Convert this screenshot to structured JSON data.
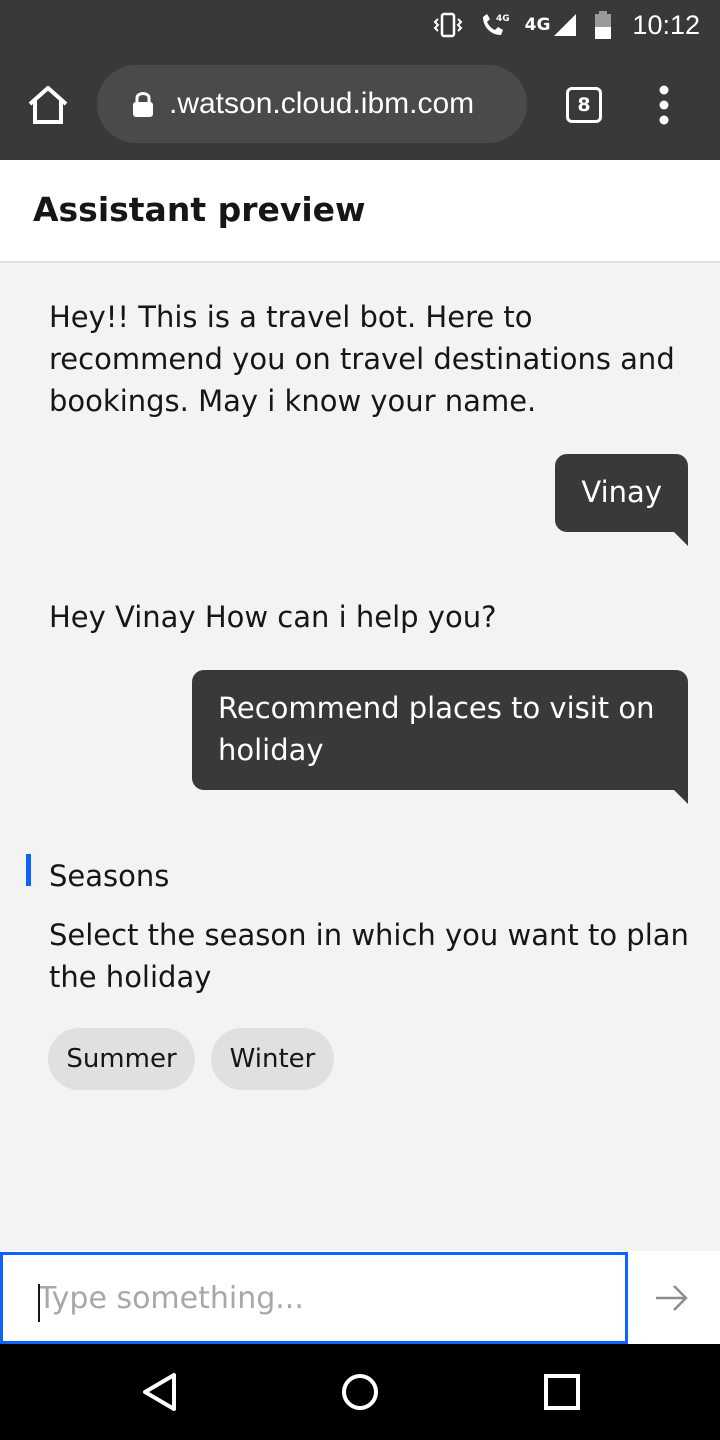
{
  "status_bar": {
    "network": "4G",
    "time": "10:12",
    "icons": [
      "vibrate-icon",
      "wifi-call-icon",
      "signal-icon",
      "battery-icon"
    ]
  },
  "browser": {
    "url": ".watson.cloud.ibm.com",
    "tab_count": "8",
    "icons": [
      "home-icon",
      "lock-icon",
      "overflow-menu-icon"
    ]
  },
  "header": {
    "title": "Assistant preview"
  },
  "chat": {
    "messages": [
      {
        "from": "bot",
        "text": "Hey!! This is a travel bot. Here to recommend you on travel destinations and bookings. May i know your name."
      },
      {
        "from": "user",
        "text": "Vinay"
      },
      {
        "from": "bot",
        "text": "Hey Vinay How can i help you?"
      },
      {
        "from": "user",
        "text": "Recommend places to visit on holiday"
      }
    ],
    "options_card": {
      "title": "Seasons",
      "description": "Select the season in which you want to plan the holiday",
      "options": [
        "Summer",
        "Winter"
      ]
    }
  },
  "input": {
    "placeholder": "Type something...",
    "value": ""
  },
  "colors": {
    "accent": "#0f62fe",
    "bubble": "#393939",
    "chrome": "#393939",
    "background": "#f3f3f3"
  }
}
